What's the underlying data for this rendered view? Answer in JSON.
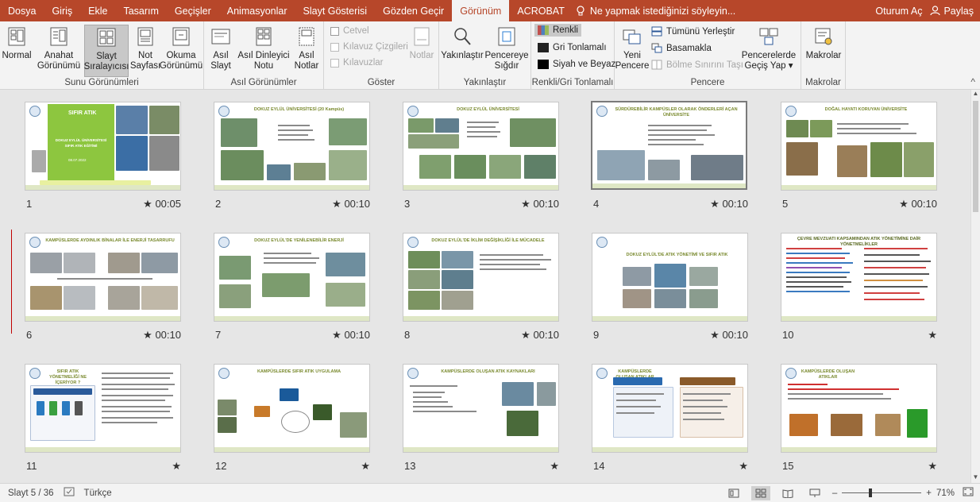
{
  "menubar": {
    "tabs": [
      "Dosya",
      "Giriş",
      "Ekle",
      "Tasarım",
      "Geçişler",
      "Animasyonlar",
      "Slayt Gösterisi",
      "Gözden Geçir",
      "Görünüm",
      "ACROBAT"
    ],
    "active_tab": "Görünüm",
    "tell_me": "Ne yapmak istediğinizi söyleyin...",
    "signin": "Oturum Aç",
    "share": "Paylaş"
  },
  "ribbon": {
    "sunu": {
      "label": "Sunu Görünümleri",
      "normal": "Normal",
      "anahat1": "Anahat",
      "anahat2": "Görünümü",
      "slayt1": "Slayt",
      "slayt2": "Sıralayıcısı",
      "not1": "Not",
      "not2": "Sayfası",
      "okuma1": "Okuma",
      "okuma2": "Görünümü"
    },
    "asil": {
      "label": "Asıl Görünümler",
      "aslayt1": "Asıl",
      "aslayt2": "Slayt",
      "adinleyici1": "Asıl Dinleyici",
      "adinleyici2": "Notu",
      "anotlar1": "Asıl",
      "anotlar2": "Notlar"
    },
    "goster": {
      "label": "Göster",
      "cetvel": "Cetvel",
      "kilavuz_cizgileri": "Kılavuz Çizgileri",
      "kilavuzlar": "Kılavuzlar",
      "notlar": "Notlar"
    },
    "yakin": {
      "label": "Yakınlaştır",
      "yakinlastir": "Yakınlaştır",
      "sigdir1": "Pencereye",
      "sigdir2": "Sığdır"
    },
    "renk": {
      "label": "Renkli/Gri Tonlamalı",
      "renkli": "Renkli",
      "gri": "Gri Tonlamalı",
      "siyah": "Siyah ve Beyaz"
    },
    "pencere": {
      "label": "Pencere",
      "yeni1": "Yeni",
      "yeni2": "Pencere",
      "tumunu": "Tümünü Yerleştir",
      "basamak": "Basamakla",
      "bolme": "Bölme Sınırını Taşı",
      "gecis1": "Pencerelerde",
      "gecis2": "Geçiş Yap"
    },
    "makro": {
      "label": "Makrolar",
      "makrolar": "Makrolar"
    }
  },
  "slides": [
    {
      "num": "1",
      "time": "00:05",
      "title": "SIFIR ATIK",
      "subtitle": "DOKUZ EYLÜL ÜNİVERSİTESİ SIFIR ATIK EĞİTİMİ",
      "date": "08.07.2022"
    },
    {
      "num": "2",
      "time": "00:10",
      "title": "DOKUZ EYLÜL ÜNİVERSİTESİ (20 Kampüs)"
    },
    {
      "num": "3",
      "time": "00:10",
      "title": "DOKUZ EYLÜL ÜNİVERSİTESİ"
    },
    {
      "num": "4",
      "time": "00:10",
      "title": "SÜRDÜREBİLİR KAMPÜSLER OLARAK ÖNDERLERİ AÇAN ÜNİVERSİTE"
    },
    {
      "num": "5",
      "time": "00:10",
      "title": "DOĞAL HAYATI KORUYAN ÜNİVERSİTE"
    },
    {
      "num": "6",
      "time": "00:10",
      "title": "KAMPÜSLERDE AYDINLIK BİNALAR İLE ENERJİ TASARRUFU"
    },
    {
      "num": "7",
      "time": "00:10",
      "title": "DOKUZ EYLÜL'DE YENİLENEBİLİR ENERJİ"
    },
    {
      "num": "8",
      "time": "00:10",
      "title": "DOKUZ EYLÜL'DE İKLİM DEĞİŞİKLİĞİ İLE MÜCADELE"
    },
    {
      "num": "9",
      "time": "00:10",
      "title": "DOKUZ EYLÜL'DE ATIK YÖNETİMİ VE SIFIR ATIK"
    },
    {
      "num": "10",
      "time": "",
      "title": "ÇEVRE MEVZUATI KAPSAMINDAN ATIK YÖNETİMİNE DAİR YÖNETMELİKLER"
    },
    {
      "num": "11",
      "time": "",
      "title": "SIFIR ATIK YÖNETMELİĞİ NE İÇERİYOR ?"
    },
    {
      "num": "12",
      "time": "",
      "title": "KAMPÜSLERDE SIFIR ATIK UYGULAMA"
    },
    {
      "num": "13",
      "time": "",
      "title": "KAMPÜSLERDE OLUŞAN ATIK KAYNAKLARI"
    },
    {
      "num": "14",
      "time": "",
      "title": "KAMPÜSLERDE OLUŞAN ATIKLAR"
    },
    {
      "num": "15",
      "time": "",
      "title": "KAMPÜSLERDE OLUŞAN ATIKLAR"
    }
  ],
  "status": {
    "slide": "Slayt 5 / 36",
    "lang": "Türkçe",
    "zoom": "71%",
    "zoom_level": 0.71
  },
  "colors": {
    "accent": "#b7472a",
    "title_green": "#7a8a2f"
  }
}
